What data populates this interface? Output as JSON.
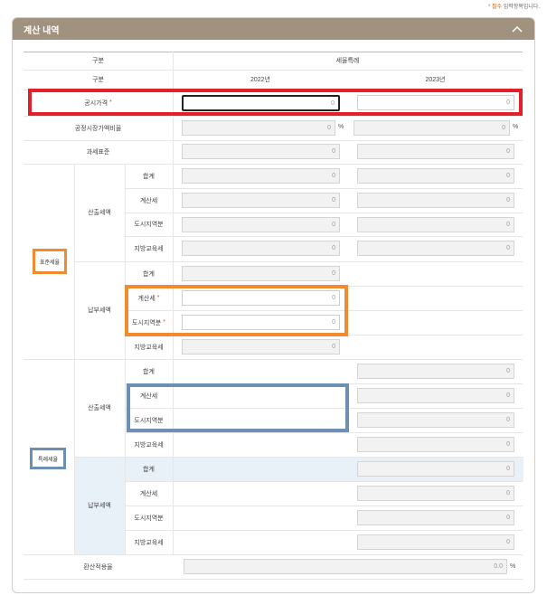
{
  "note": {
    "star": "*",
    "required": "필수",
    "text": "입력항목입니다."
  },
  "panel": {
    "title": "계산 내역"
  },
  "header": {
    "gubun1": "구분",
    "tax_change": "세율특례",
    "gubun2": "구분",
    "year1": "2022년",
    "year2": "2023년"
  },
  "rows": {
    "assessed_price": "공시가격",
    "required_mark": "*",
    "fair_market_ratio": "공정시장가액비율",
    "tax_base": "과세표준",
    "standard_rate": "표준세율",
    "special_rate": "특례세율",
    "calc_amount": "산출세액",
    "payment_amount": "납부세액",
    "total": "합계",
    "calc_tax": "계산세",
    "urban_area": "도시지역분",
    "local_edu": "지방교육세",
    "burden_cap": "환산적용율"
  },
  "values": {
    "assessed_2022": "0",
    "assessed_2023": "0",
    "ratio_2022": "0",
    "ratio_2023": "0",
    "base_2022": "0",
    "base_2023": "0",
    "std_calc_total_2022": "0",
    "std_calc_total_2023": "0",
    "std_calc_tax_2022": "0",
    "std_calc_tax_2023": "0",
    "std_calc_urban_2022": "0",
    "std_calc_urban_2023": "0",
    "std_calc_edu_2022": "0",
    "std_calc_edu_2023": "0",
    "std_pay_total_2022": "0",
    "std_pay_tax_2022": "0",
    "std_pay_urban_2022": "0",
    "std_pay_edu_2022": "0",
    "sp_calc_total_2023": "0",
    "sp_calc_tax_2023": "0",
    "sp_calc_urban_2023": "0",
    "sp_calc_edu_2023": "0",
    "sp_pay_total_2023": "0",
    "sp_pay_tax_2023": "0",
    "sp_pay_urban_2023": "0",
    "sp_pay_edu_2023": "0",
    "burden_cap": "0.0",
    "percent": "%"
  },
  "colors": {
    "header_bg": "#a0927e",
    "highlight_red": "#e3202a",
    "highlight_orange": "#f28a2e",
    "highlight_blue": "#6e8fb5",
    "required": "#e05a00"
  }
}
